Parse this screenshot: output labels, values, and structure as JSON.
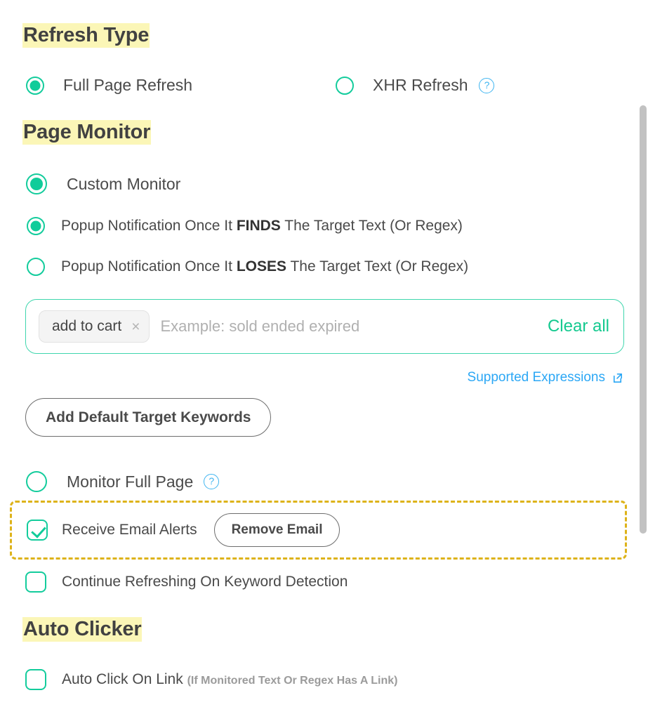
{
  "sections": {
    "refresh_type": {
      "heading": "Refresh Type",
      "options": [
        {
          "label": "Full Page Refresh",
          "selected": true,
          "help": false
        },
        {
          "label": "XHR Refresh",
          "selected": false,
          "help": true
        }
      ]
    },
    "page_monitor": {
      "heading": "Page Monitor",
      "custom_monitor": {
        "label": "Custom Monitor",
        "selected": true
      },
      "sub_options": [
        {
          "prefix": "Popup Notification Once It ",
          "emphasis": "FINDS",
          "suffix": " The Target Text (Or Regex)",
          "selected": true
        },
        {
          "prefix": "Popup Notification Once It ",
          "emphasis": "LOSES",
          "suffix": " The Target Text (Or Regex)",
          "selected": false
        }
      ],
      "keyword_input": {
        "chips": [
          {
            "text": "add to cart",
            "remove_glyph": "×"
          }
        ],
        "placeholder": "Example: sold ended expired",
        "clear_all_label": "Clear all"
      },
      "supported_expressions_link": "Supported Expressions",
      "add_default_keywords_button": "Add Default Target Keywords",
      "monitor_full_page": {
        "label": "Monitor Full Page",
        "selected": false,
        "help": true
      },
      "receive_email_alerts": {
        "label": "Receive Email Alerts",
        "checked": true,
        "button": "Remove Email"
      },
      "continue_refreshing": {
        "label": "Continue Refreshing On Keyword Detection",
        "checked": false
      }
    },
    "auto_clicker": {
      "heading": "Auto Clicker",
      "auto_click_on_link": {
        "label": "Auto Click On Link",
        "note": "(If Monitored Text Or Regex Has A Link)",
        "checked": false
      }
    }
  },
  "help_glyph": "?",
  "colors": {
    "accent_green": "#10cc9a",
    "link_blue": "#2ba7f5",
    "clear_all_green": "#14c98f",
    "highlight_yellow": "#fbf6b7",
    "dashed_gold": "#ddb31a",
    "text_dark": "#4a4a4a",
    "muted_grey": "#9b9b9b"
  }
}
